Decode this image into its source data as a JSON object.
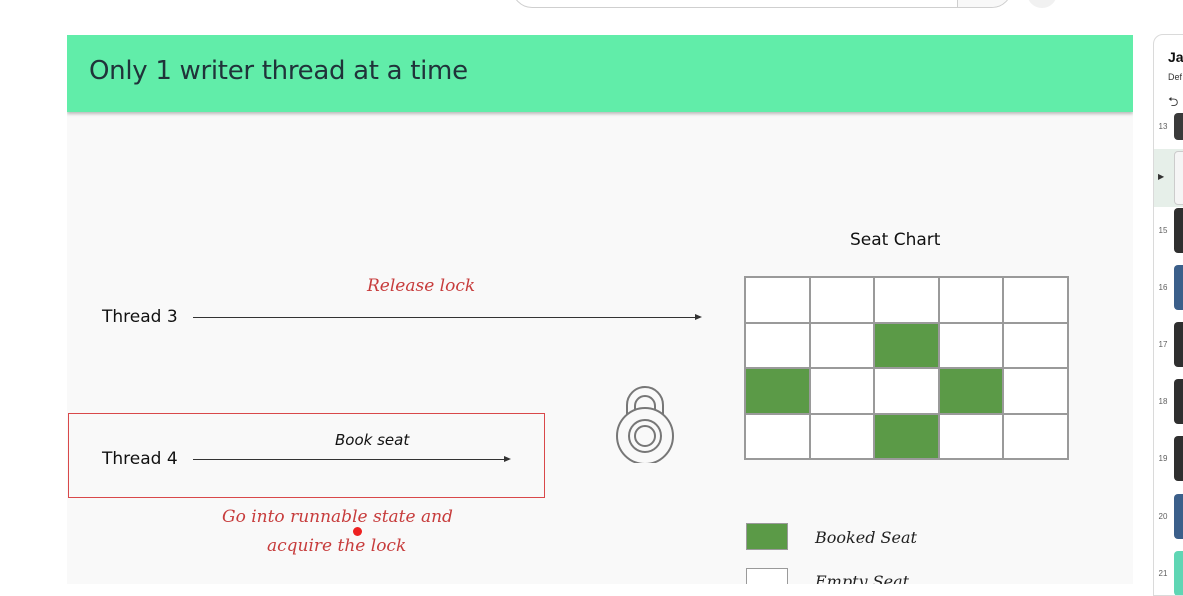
{
  "slide": {
    "title": "Only 1 writer thread at a time",
    "thread3": {
      "label": "Thread 3",
      "action": "Release lock"
    },
    "thread4": {
      "label": "Thread 4",
      "action": "Book seat"
    },
    "note_line1": "Go into runnable state and",
    "note_line2": "acquire the lock",
    "seat_chart": {
      "title": "Seat Chart",
      "rows": [
        [
          "empty",
          "empty",
          "empty",
          "empty",
          "empty"
        ],
        [
          "empty",
          "empty",
          "booked",
          "empty",
          "empty"
        ],
        [
          "booked",
          "empty",
          "empty",
          "booked",
          "empty"
        ],
        [
          "empty",
          "empty",
          "booked",
          "empty",
          "empty"
        ]
      ]
    },
    "legend": {
      "booked": "Booked Seat",
      "empty": "Empty Seat"
    }
  },
  "playlist": {
    "title": "Jav",
    "subtitle": "Def",
    "items": [
      {
        "number": "13",
        "color": "#3a3a3a"
      },
      {
        "number": "",
        "color": "#f5f5f5",
        "active": true
      },
      {
        "number": "15",
        "color": "#2f2f2f"
      },
      {
        "number": "16",
        "color": "#3b5f8a"
      },
      {
        "number": "17",
        "color": "#2f2f2f"
      },
      {
        "number": "18",
        "color": "#2f2f2f"
      },
      {
        "number": "19",
        "color": "#2f2f2f"
      },
      {
        "number": "20",
        "color": "#3b5f8a"
      },
      {
        "number": "21",
        "color": "#5fd6b4"
      }
    ]
  },
  "colors": {
    "header": "#61eda9",
    "booked": "#5b9a47",
    "annotation": "#c73c3c"
  },
  "icons": [
    "search-icon",
    "mic-icon",
    "lock-icon",
    "loop-icon",
    "play-indicator-icon"
  ]
}
